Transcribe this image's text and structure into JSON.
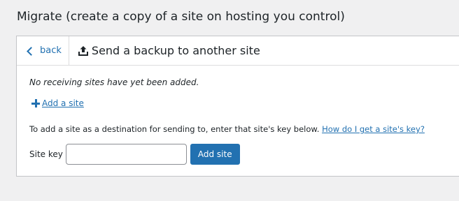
{
  "page": {
    "title": "Migrate (create a copy of a site on hosting you control)"
  },
  "header": {
    "back_label": "back",
    "title": "Send a backup to another site",
    "title_icon": "upload-icon"
  },
  "body": {
    "no_sites_message": "No receiving sites have yet been added.",
    "add_site_label": "Add a site",
    "add_site_icon": "plus-icon",
    "instructions_text": "To add a site as a destination for sending to, enter that site's key below. ",
    "instructions_link": "How do I get a site's key?",
    "site_key_label": "Site key",
    "site_key_value": "",
    "site_key_placeholder": "",
    "add_button_label": "Add site"
  },
  "colors": {
    "accent": "#2271b1",
    "background": "#f0f0f1",
    "panel": "#ffffff",
    "border": "#c3c4c7"
  }
}
